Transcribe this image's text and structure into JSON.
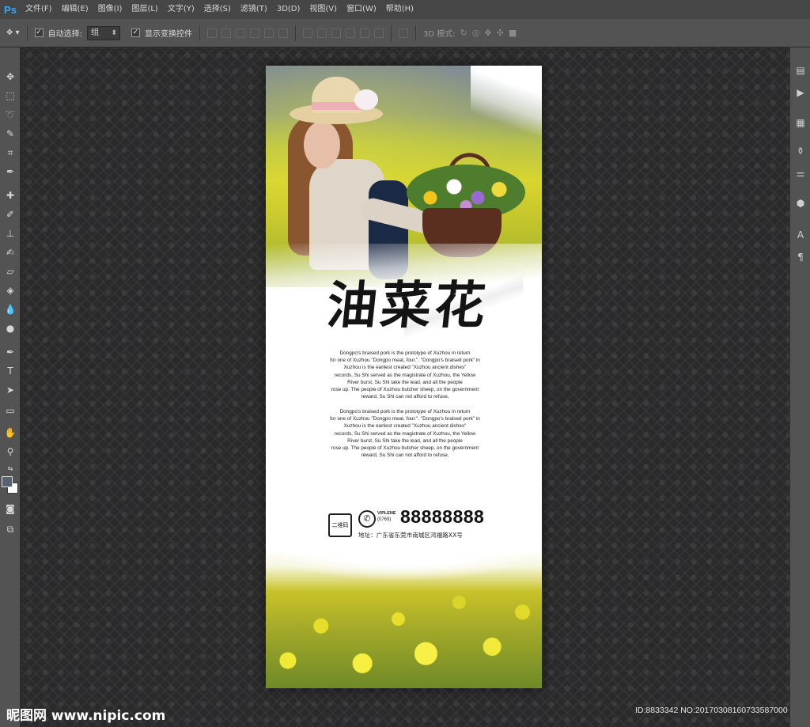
{
  "app": {
    "logo": "Ps"
  },
  "menu": [
    "文件(F)",
    "编辑(E)",
    "图像(I)",
    "图层(L)",
    "文字(Y)",
    "选择(S)",
    "滤镜(T)",
    "3D(D)",
    "视图(V)",
    "窗口(W)",
    "帮助(H)"
  ],
  "options": {
    "auto_select_label": "自动选择:",
    "auto_select_value": "组",
    "show_transform_label": "显示变换控件",
    "mode_3d_label": "3D 模式:"
  },
  "tools": [
    "move-icon",
    "marquee-icon",
    "lasso-icon",
    "quick-select-icon",
    "crop-icon",
    "eyedropper-icon",
    "healing-icon",
    "brush-icon",
    "stamp-icon",
    "history-brush-icon",
    "eraser-icon",
    "paint-bucket-icon",
    "blur-icon",
    "dodge-icon",
    "pen-icon",
    "type-icon",
    "path-select-icon",
    "rectangle-icon",
    "hand-icon",
    "zoom-icon"
  ],
  "poster": {
    "title": "油菜花",
    "paragraph1": [
      "Dongpo's braised pork is the prototype of Xuzhou in return",
      "for one of Xuzhou \"Dongpo meat, four.\". \"Dongpo's braised pork\" in",
      "Xuzhou is the earliest created \"Xuzhou ancient dishes\"",
      "records, Su Shi served as the magistrate of Xuzhou, the Yellow",
      "River burst, Su Shi take the lead, and all the people",
      "rose up. The people of Xuzhou butcher sheep, on the government",
      "reward, Su Shi can not afford to refuse,"
    ],
    "paragraph2": [
      "Dongpo's braised pork is the prototype of Xuzhou in return",
      "for one of Xuzhou \"Dongpo meat, four.\". \"Dongpo's braised pork\" in",
      "Xuzhou is the earliest created \"Xuzhou ancient dishes\"",
      "records, Su Shi served as the magistrate of Xuzhou, the Yellow",
      "River burst, Su Shi take the lead, and all the people",
      "rose up. The people of Xuzhou butcher sheep, on the government",
      "reward, Su Shi can not afford to refuse,"
    ],
    "qr_label": "二维码",
    "hotline_en": "VIPLENE",
    "area_code": "(0769)",
    "phone": "88888888",
    "address": "地址：广东省东莞市南城区鸿福路XX号"
  },
  "watermark": {
    "logo": "昵图网 www.nipic.com",
    "id": "ID:8833342 NO:20170308160733587000"
  },
  "colors": {
    "menubar": "#464646",
    "panel": "#535353",
    "canvas": "#2a2a2b",
    "accent": "#31a8ff"
  }
}
